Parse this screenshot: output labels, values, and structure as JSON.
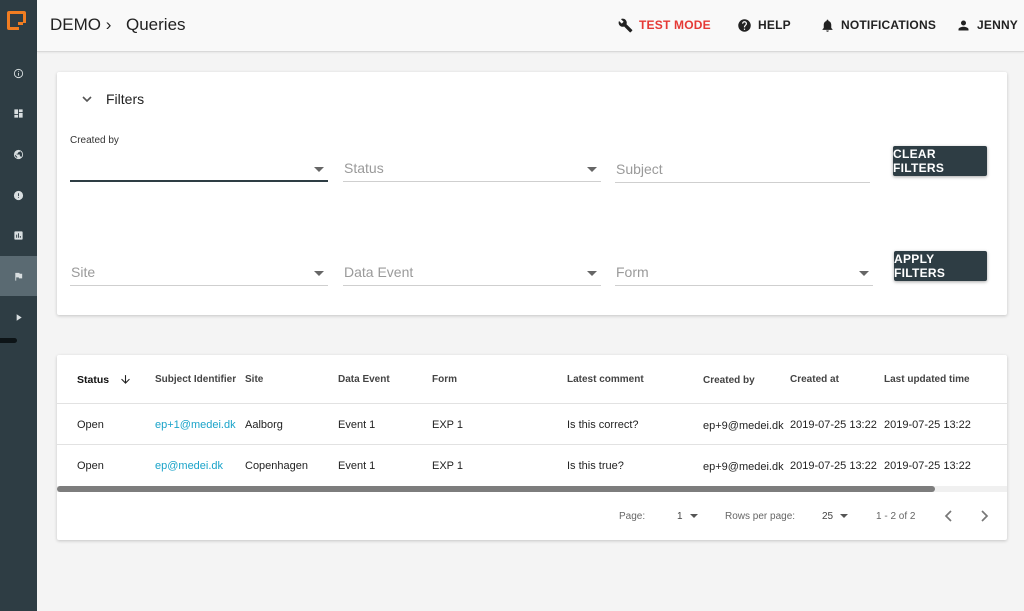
{
  "sidebar": {
    "logo": "app-logo",
    "items": [
      {
        "icon": "info-icon"
      },
      {
        "icon": "dashboard-icon"
      },
      {
        "icon": "globe-icon"
      },
      {
        "icon": "alert-icon"
      },
      {
        "icon": "chart-icon"
      },
      {
        "icon": "flag-icon",
        "active": true
      },
      {
        "icon": "play-icon"
      }
    ]
  },
  "header": {
    "breadcrumb_root": "DEMO ›",
    "breadcrumb_current": "Queries",
    "test_mode": "TEST MODE",
    "help": "HELP",
    "notifications": "NOTIFICATIONS",
    "user": "JENNY",
    "test_mode_color": "#e53935"
  },
  "filters": {
    "title": "Filters",
    "created_by_label": "Created by",
    "status_placeholder": "Status",
    "subject_placeholder": "Subject",
    "site_placeholder": "Site",
    "data_event_placeholder": "Data Event",
    "form_placeholder": "Form",
    "clear_button": "CLEAR FILTERS",
    "apply_button": "APPLY FILTERS"
  },
  "table": {
    "columns": [
      "Status",
      "Subject Identifier",
      "Site",
      "Data Event",
      "Form",
      "Latest comment",
      "Created by",
      "Created at",
      "Last updated time"
    ],
    "rows": [
      [
        "Open",
        "ep+1@medei.dk",
        "Aalborg",
        "Event 1",
        "EXP 1",
        "Is this correct?",
        "ep+9@medei.dk",
        "2019-07-25 13:22",
        "2019-07-25 13:22"
      ],
      [
        "Open",
        "ep@medei.dk",
        "Copenhagen",
        "Event 1",
        "EXP 1",
        "Is this true?",
        "ep+9@medei.dk",
        "2019-07-25 13:22",
        "2019-07-25 13:22"
      ]
    ],
    "link_color": "#1aa3c9"
  },
  "pagination": {
    "page_label": "Page:",
    "page_value": "1",
    "rows_label": "Rows per page:",
    "rows_value": "25",
    "range": "1 - 2 of 2"
  },
  "colors": {
    "sidebar": "#2e3d44",
    "accent": "#f07d22",
    "button": "#2e3d44"
  }
}
